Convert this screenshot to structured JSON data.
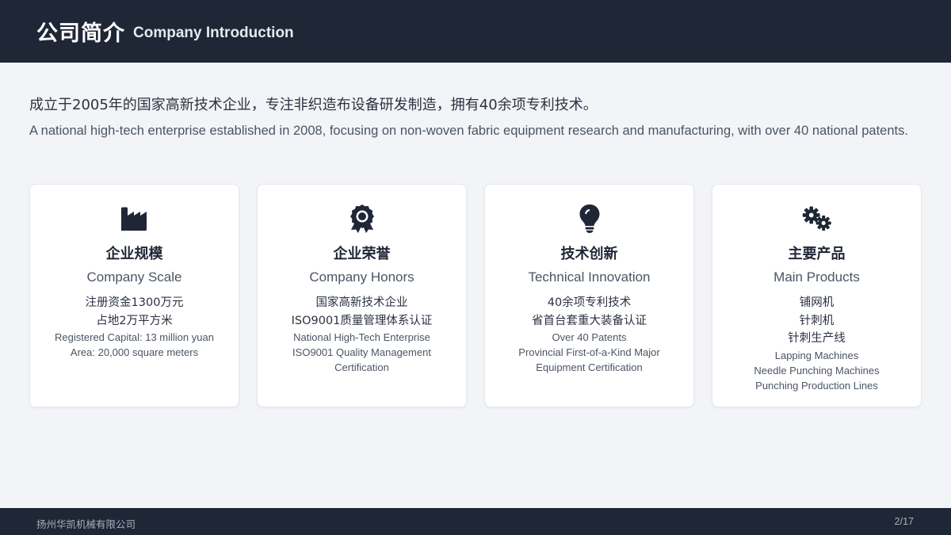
{
  "header": {
    "title_cn": "公司简介",
    "title_en": "Company Introduction"
  },
  "intro": {
    "cn": "成立于2005年的国家高新技术企业，专注非织造布设备研发制造，拥有40余项专利技术。",
    "en": "A national high-tech enterprise established in 2008, focusing on non-woven fabric equipment research and manufacturing, with over 40 national patents."
  },
  "colors": {
    "header_bg": "#1f2636",
    "icon": "#1f2636",
    "page_bg": "#f2f4f7"
  },
  "cards": [
    {
      "icon": "factory-icon",
      "title_cn": "企业规模",
      "title_en": "Company Scale",
      "lines_cn": [
        "注册资金1300万元",
        "占地2万平方米"
      ],
      "lines_en": [
        "Registered Capital: 13 million yuan",
        "Area: 20,000 square meters"
      ]
    },
    {
      "icon": "award-icon",
      "title_cn": "企业荣誉",
      "title_en": "Company Honors",
      "lines_cn": [
        "国家高新技术企业",
        "ISO9001质量管理体系认证"
      ],
      "lines_en": [
        "National High-Tech Enterprise",
        "ISO9001 Quality Management",
        "Certification"
      ]
    },
    {
      "icon": "lightbulb-icon",
      "title_cn": "技术创新",
      "title_en": "Technical Innovation",
      "lines_cn": [
        "40余项专利技术",
        "省首台套重大装备认证"
      ],
      "lines_en": [
        "Over 40 Patents",
        "Provincial First-of-a-Kind Major",
        "Equipment Certification"
      ]
    },
    {
      "icon": "gears-icon",
      "title_cn": "主要产品",
      "title_en": "Main Products",
      "lines_cn": [
        "铺网机",
        "针刺机",
        "针刺生产线"
      ],
      "lines_en": [
        "Lapping Machines",
        "Needle Punching Machines",
        "Punching Production Lines"
      ]
    }
  ],
  "footer": {
    "company": "扬州华凯机械有限公司",
    "page": "2/17"
  }
}
